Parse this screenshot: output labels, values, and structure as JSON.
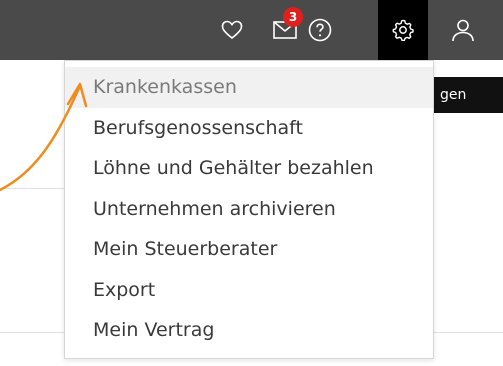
{
  "topbar": {
    "icons": [
      "heart-icon",
      "mail-icon",
      "help-icon",
      "gear-icon",
      "user-icon"
    ],
    "mail_badge": "3",
    "colors": {
      "bar": "#4a4a4a",
      "badge": "#e0201f",
      "active": "#000000"
    }
  },
  "background": {
    "button_label": "gen"
  },
  "settings_menu": {
    "items": [
      {
        "label": "Krankenkassen"
      },
      {
        "label": "Berufsgenossenschaft"
      },
      {
        "label": "Löhne und Gehälter bezahlen"
      },
      {
        "label": "Unternehmen archivieren"
      },
      {
        "label": "Mein Steuerberater"
      },
      {
        "label": "Export"
      },
      {
        "label": "Mein Vertrag"
      }
    ]
  },
  "annotation": {
    "arrow_color": "#f08c1e"
  }
}
